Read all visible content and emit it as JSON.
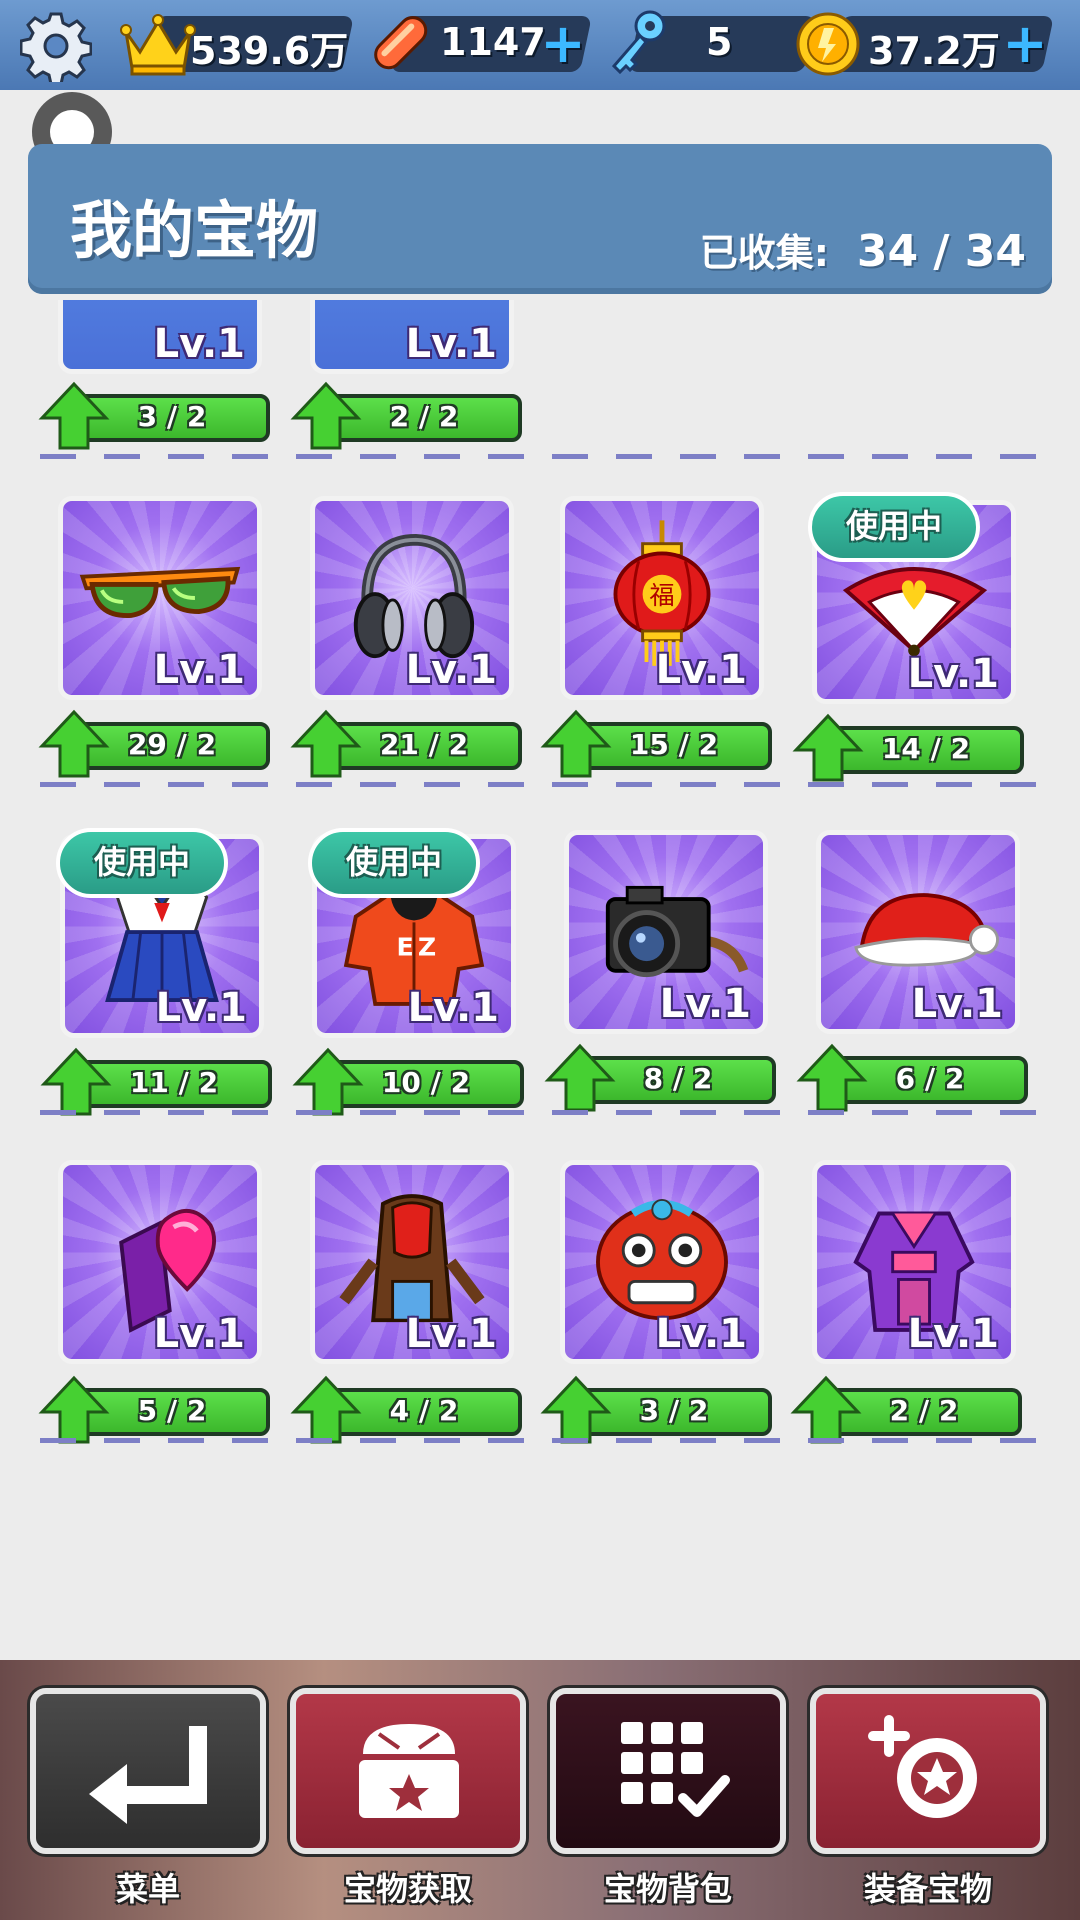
{
  "topbar": {
    "settings_icon": "gear-icon",
    "crown": "539.6万",
    "boards": "1147",
    "keys": "5",
    "coins": "37.2万",
    "plus": "+"
  },
  "header": {
    "title": "我的宝物",
    "collected_label": "已收集:",
    "collected_count": "34 / 34"
  },
  "badge_in_use": "使用中",
  "level_label": "Lv.1",
  "rows": [
    {
      "items": [
        {
          "name": "item-partial-1",
          "progress": "3 / 2"
        },
        {
          "name": "item-partial-2",
          "progress": "2 / 2"
        }
      ]
    },
    {
      "items": [
        {
          "name": "sunglasses",
          "progress": "29 / 2"
        },
        {
          "name": "headphones",
          "progress": "21 / 2"
        },
        {
          "name": "red-lantern",
          "progress": "15 / 2"
        },
        {
          "name": "heart-fan",
          "progress": "14 / 2",
          "in_use": true
        }
      ]
    },
    {
      "items": [
        {
          "name": "sailor-uniform",
          "progress": "11 / 2",
          "in_use": true
        },
        {
          "name": "ez-hoodie",
          "progress": "10 / 2",
          "in_use": true
        },
        {
          "name": "camera",
          "progress": "8 / 2"
        },
        {
          "name": "santa-hat",
          "progress": "6 / 2"
        }
      ]
    },
    {
      "items": [
        {
          "name": "heart-ring",
          "progress": "5 / 2"
        },
        {
          "name": "hooded-vest",
          "progress": "4 / 2"
        },
        {
          "name": "lion-dance-mask",
          "progress": "3 / 2"
        },
        {
          "name": "purple-costume",
          "progress": "2 / 2"
        }
      ]
    }
  ],
  "nav": {
    "menu": "菜单",
    "obtain": "宝物获取",
    "backpack": "宝物背包",
    "equip": "装备宝物"
  },
  "colors": {
    "topbar": "#5b88c4",
    "header": "#5b89b6",
    "card_purple": "#a070f0",
    "progress_green": "#4ccd3a",
    "in_use_badge": "#33b296",
    "menu_button": "#3a3a3a",
    "red_button": "#9e2f3c",
    "selected_button": "#2a0f18"
  }
}
